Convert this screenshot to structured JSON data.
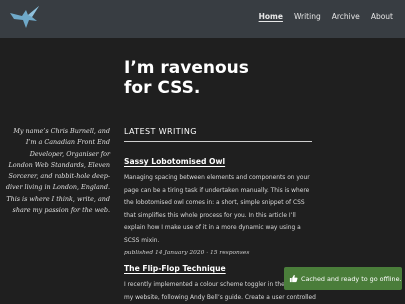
{
  "nav": {
    "items": [
      {
        "label": "Home",
        "active": true
      },
      {
        "label": "Writing",
        "active": false
      },
      {
        "label": "Archive",
        "active": false
      },
      {
        "label": "About",
        "active": false
      }
    ]
  },
  "hero": {
    "line1": "I’m ravenous",
    "line2": "for CSS."
  },
  "bio": {
    "text": "My name’s Chris Burnell, and I’m a Canadian Front End Developer, Organiser for London Web Standards, Eleven Sorcerer, and rabbit-hole deep-diver living in London, England. This is where I think, write, and share my passion for the web."
  },
  "latest": {
    "heading": "LATEST WRITING",
    "posts": [
      {
        "title": "Sassy Lobotomised Owl",
        "excerpt": "Managing spacing between elements and components on your page can be a tiring task if undertaken manually. This is where the lobotomised owl comes in: a short, simple snippet of CSS that simplifies this whole process for you. In this article I’ll explain how I make use of it in a more dynamic way using a SCSS mixin.",
        "meta": "published 14 January 2020 · 15 responses"
      },
      {
        "title": "The Flip-Flop Technique",
        "excerpt": "I recently implemented a colour scheme toggler in the footer of my website, following Andy Bell’s guide. Create a user controlled dark"
      }
    ]
  },
  "toast": {
    "text": "Cached and ready to go offline.",
    "color": "#4a7d3a"
  },
  "colors": {
    "header_bg": "#383d42",
    "page_bg": "#1f1f1f",
    "logo": "#6fa9c9"
  }
}
